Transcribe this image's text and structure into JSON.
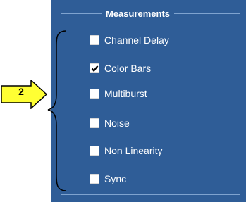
{
  "group": {
    "title": "Measurements"
  },
  "items": [
    {
      "label": "Channel Delay",
      "checked": false
    },
    {
      "label": "Color Bars",
      "checked": true
    },
    {
      "label": "Multiburst",
      "checked": false
    },
    {
      "label": "Noise",
      "checked": false
    },
    {
      "label": "Non Linearity",
      "checked": false
    },
    {
      "label": "Sync",
      "checked": false
    }
  ],
  "callout": {
    "number": "2"
  },
  "colors": {
    "panel_bg": "#2f5d97",
    "frame": "#7fa3cf",
    "text": "#ffffff",
    "callout_fill": "#ffff33"
  }
}
